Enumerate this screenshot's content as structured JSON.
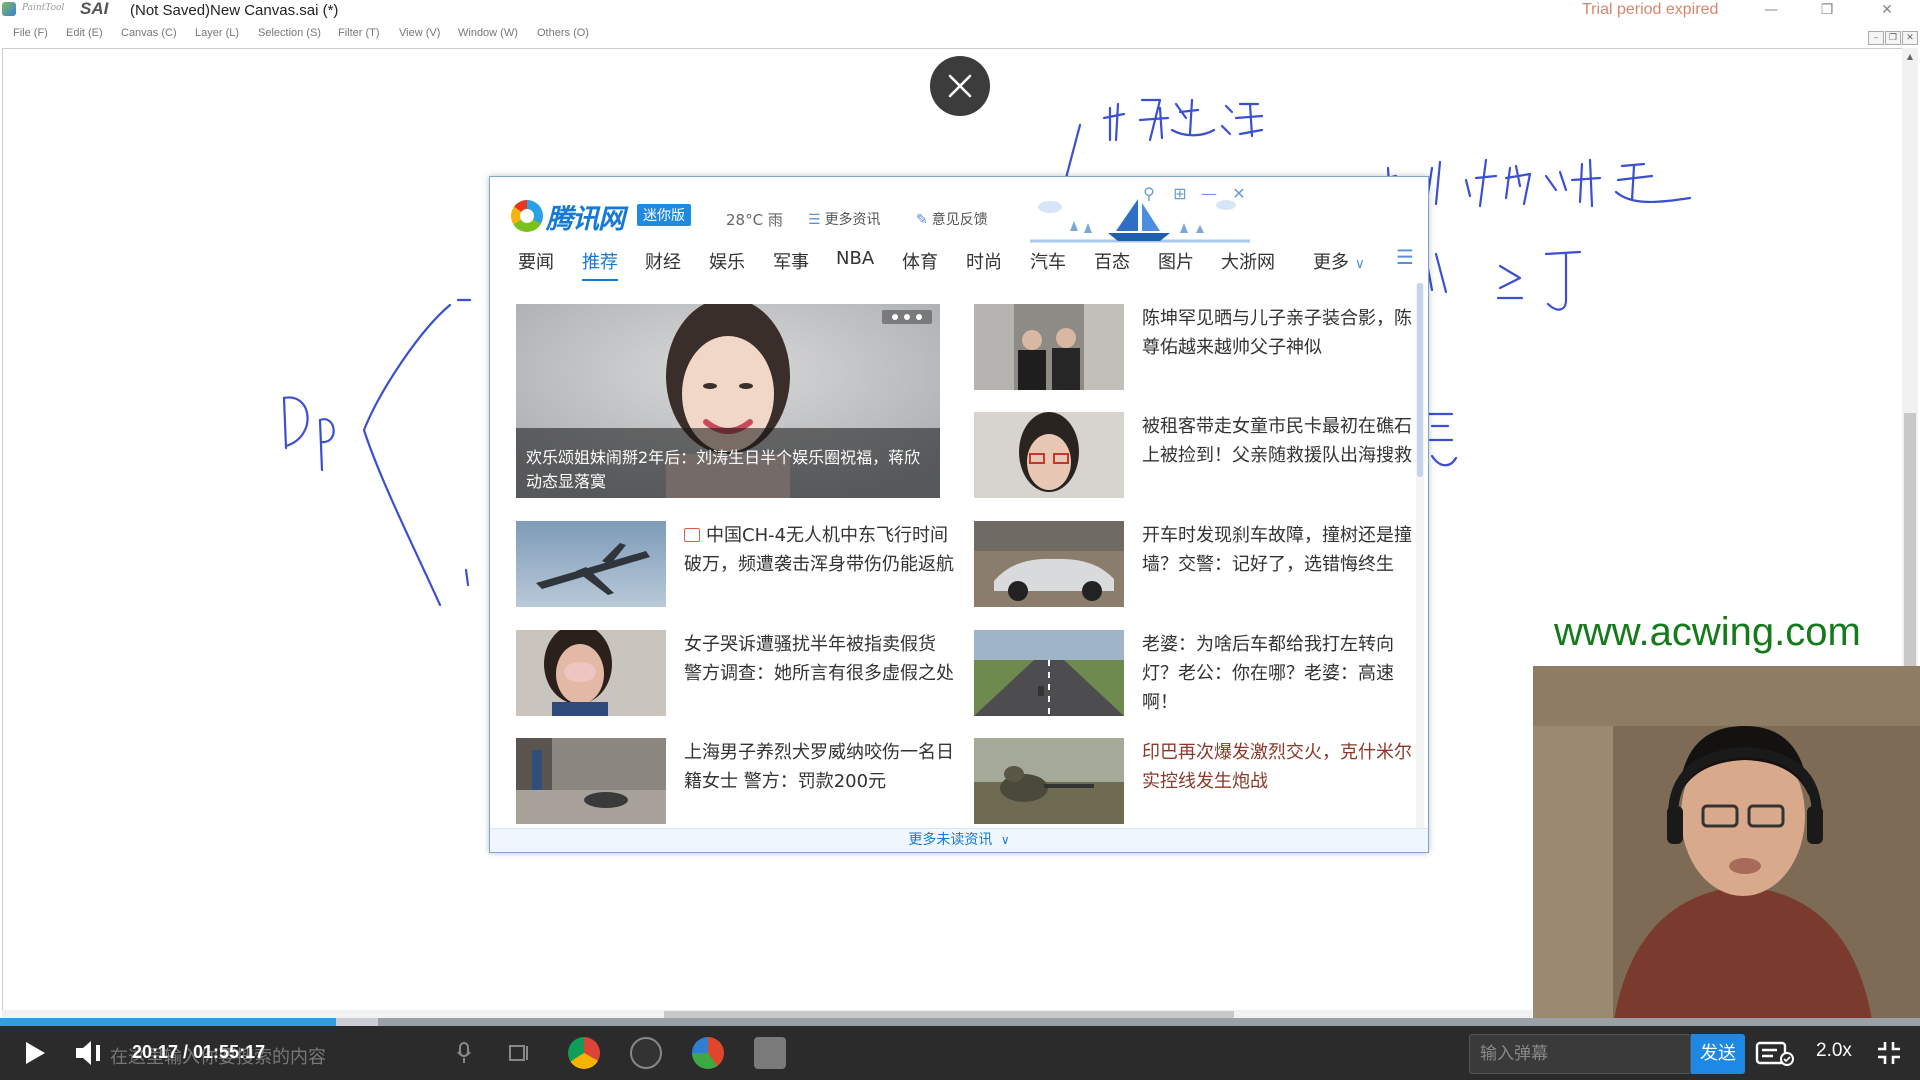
{
  "app": {
    "brand_small": "PaintTool",
    "brand": "SAI",
    "window_title": "(Not Saved)New Canvas.sai (*)",
    "trial_text": "Trial period expired"
  },
  "menu": [
    "File (F)",
    "Edit (E)",
    "Canvas (C)",
    "Layer (L)",
    "Selection (S)",
    "Filter (T)",
    "View (V)",
    "Window (W)",
    "Others (O)"
  ],
  "news_window": {
    "logo_text": "腾讯网",
    "mini_label": "迷你版",
    "weather": "28°C 雨",
    "more_info": "更多资讯",
    "feedback": "意见反馈",
    "tabs": [
      "要闻",
      "推荐",
      "财经",
      "娱乐",
      "军事",
      "NBA",
      "体育",
      "时尚",
      "汽车",
      "百态",
      "图片",
      "大浙网"
    ],
    "active_tab": "推荐",
    "more_label": "更多",
    "hero_caption": "欢乐颂姐妹闹掰2年后：刘涛生日半个娱乐圈祝福，蒋欣动态显落寞",
    "items": [
      {
        "title": "陈坤罕见晒与儿子亲子装合影，陈尊佑越来越帅父子神似"
      },
      {
        "title": "被租客带走女童市民卡最初在礁石上被捡到！父亲随救援队出海搜救"
      },
      {
        "title": "中国CH-4无人机中东飞行时间破万，频遭袭击浑身带伤仍能返航",
        "has_picture_icon": true
      },
      {
        "title": "开车时发现刹车故障，撞树还是撞墙？交警：记好了，选错悔终生"
      },
      {
        "title": "女子哭诉遭骚扰半年被指卖假货 警方调查：她所言有很多虚假之处"
      },
      {
        "title": "老婆：为啥后车都给我打左转向灯？老公：你在哪？老婆：高速啊！"
      },
      {
        "title": "上海男子养烈犬罗威纳咬伤一名日籍女士 警方：罚款200元"
      },
      {
        "title": "印巴再次爆发激烈交火，克什米尔实控线发生炮战"
      }
    ],
    "footer": "更多未读资讯"
  },
  "watermark": "www.acwing.com",
  "player": {
    "time": "20:17 / 01:55:17",
    "ghost_text": "在这里输入你要搜索的内容",
    "danmu_placeholder": "输入弹幕",
    "send_label": "发送",
    "speed": "2.0x",
    "progress_fraction": 0.175,
    "buffer_fraction": 0.197
  },
  "colors": {
    "accent": "#1679d6",
    "ink": "#3b4fd1",
    "trial": "#d9866c",
    "watermark": "#157a1c",
    "player_bg": "#2b2b2b",
    "send_button": "#1e88e5"
  }
}
